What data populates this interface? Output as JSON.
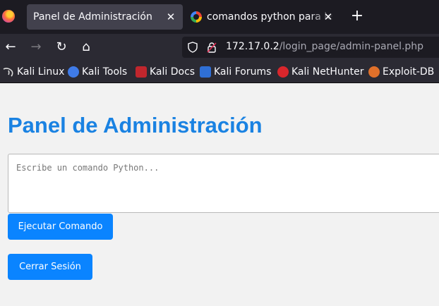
{
  "tabs": [
    {
      "title": "Panel de Administración",
      "active": true,
      "icon": "firefox-icon"
    },
    {
      "title": "comandos python para leer",
      "active": false,
      "icon": "google-icon"
    }
  ],
  "tab_close_glyph": "✕",
  "new_tab_glyph": "+",
  "nav": {
    "back_glyph": "←",
    "forward_glyph": "→",
    "reload_glyph": "↻",
    "home_glyph": "⌂",
    "url_host": "172.17.0.2",
    "url_path": "/login_page/admin-panel.php"
  },
  "bookmarks": [
    {
      "label": "Kali Linux",
      "icon": "kali-dragon-icon",
      "color": "#dddddd"
    },
    {
      "label": "Kali Tools",
      "icon": "kali-tools-icon",
      "color": "#3f7be8"
    },
    {
      "label": "Kali Docs",
      "icon": "kali-docs-icon",
      "color": "#c0262d"
    },
    {
      "label": "Kali Forums",
      "icon": "kali-forums-icon",
      "color": "#2f6fd6"
    },
    {
      "label": "Kali NetHunter",
      "icon": "kali-nethunter-icon",
      "color": "#d9262c"
    },
    {
      "label": "Exploit-DB",
      "icon": "exploit-db-icon",
      "color": "#e0702a"
    }
  ],
  "page": {
    "title": "Panel de Administración",
    "command_placeholder": "Escribe un comando Python...",
    "command_value": "",
    "execute_button": "Ejecutar Comando",
    "logout_button": "Cerrar Sesión"
  },
  "colors": {
    "accent": "#0a84ff",
    "title": "#1a82e2",
    "page_bg": "#f2f2f2",
    "chrome_bg": "#2b2a33"
  }
}
